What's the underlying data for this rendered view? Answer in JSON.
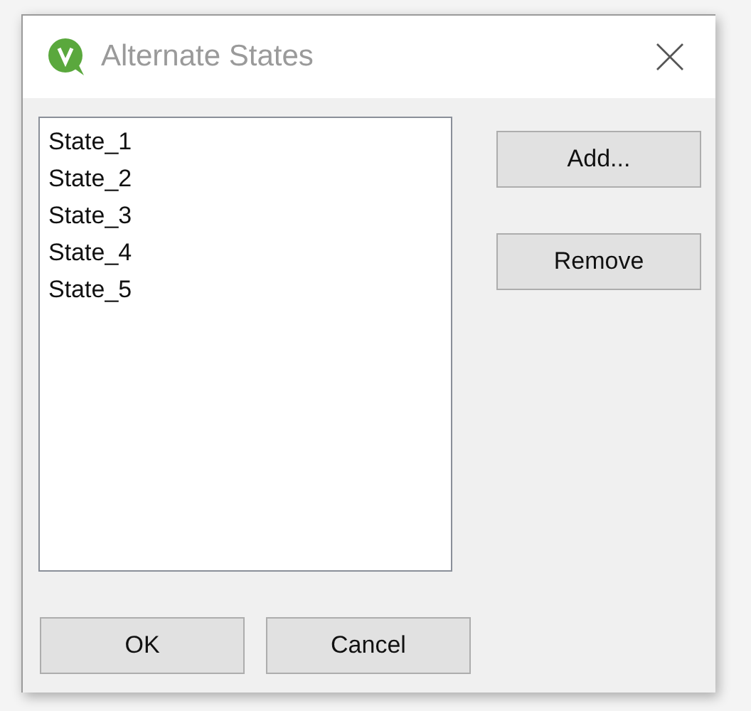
{
  "window": {
    "title": "Alternate States"
  },
  "states": [
    {
      "label": "State_1"
    },
    {
      "label": "State_2"
    },
    {
      "label": "State_3"
    },
    {
      "label": "State_4"
    },
    {
      "label": "State_5"
    }
  ],
  "side_buttons": [
    "Add...",
    "Remove"
  ],
  "buttons": [
    "OK",
    "Cancel"
  ]
}
